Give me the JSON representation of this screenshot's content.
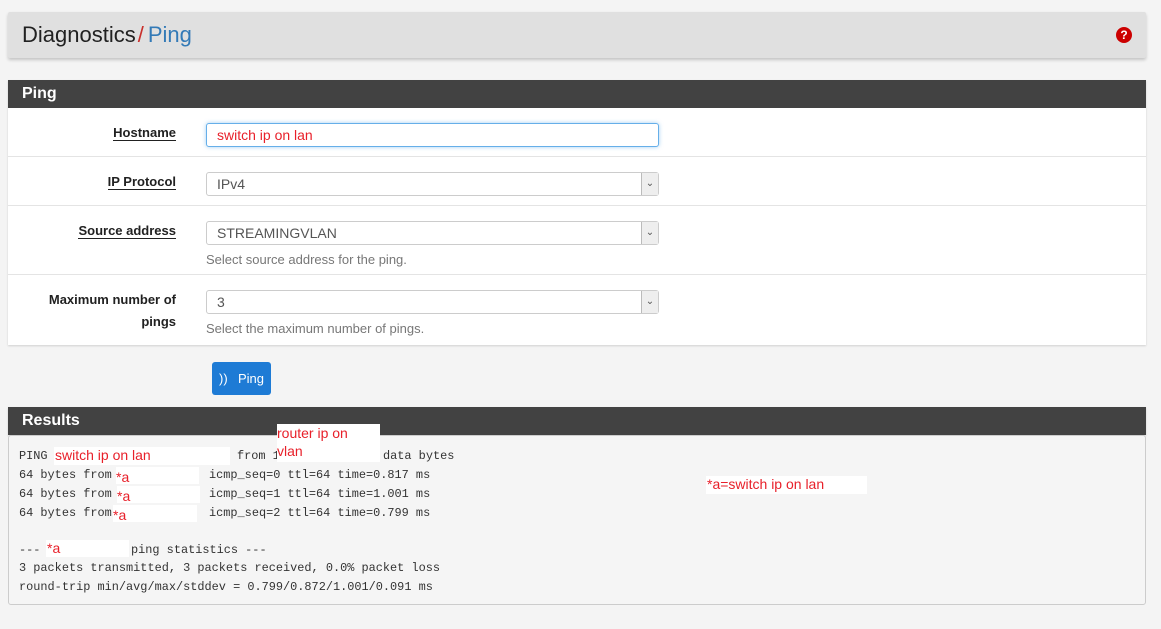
{
  "breadcrumb": {
    "parent": "Diagnostics",
    "separator": "/",
    "current": "Ping"
  },
  "help_icon": "question-circle-icon",
  "ping_panel": {
    "title": "Ping",
    "hostname": {
      "label": "Hostname",
      "value": "switch ip on lan"
    },
    "ip_protocol": {
      "label": "IP Protocol",
      "value": "IPv4"
    },
    "source_address": {
      "label": "Source address",
      "value": "STREAMINGVLAN",
      "help": "Select source address for the ping."
    },
    "max_pings": {
      "label_1": "Maximum number of",
      "label_2": "pings",
      "value": "3",
      "help": "Select the maximum number of pings."
    },
    "button": "Ping",
    "button_icon": "rss-icon"
  },
  "results": {
    "title": "Results",
    "line1": {
      "prefix": "PING",
      "host": "switch ip on lan",
      "from": "from 1",
      "router_1": "router ip on",
      "router_2": "vlan",
      "suffix": "data bytes"
    },
    "replies": [
      {
        "prefix": "64 bytes from",
        "mark": "*a",
        "rest": "icmp_seq=0 ttl=64 time=0.817 ms"
      },
      {
        "prefix": "64 bytes from",
        "mark": "*a",
        "rest": "icmp_seq=1 ttl=64 time=1.001 ms"
      },
      {
        "prefix": "64 bytes from",
        "mark": "*a",
        "rest": "icmp_seq=2 ttl=64 time=0.799 ms"
      }
    ],
    "stats_prefix": "---",
    "stats_mark": "*a",
    "stats_suffix": "ping statistics ---",
    "packets": "3 packets transmitted, 3 packets received, 0.0% packet loss",
    "rtt": "round-trip min/avg/max/stddev = 0.799/0.872/1.001/0.091 ms",
    "legend": "*a=switch ip on lan"
  },
  "colors": {
    "accent": "#1e7bd5",
    "panel_header": "#424242",
    "annotation": "#e8202a"
  }
}
